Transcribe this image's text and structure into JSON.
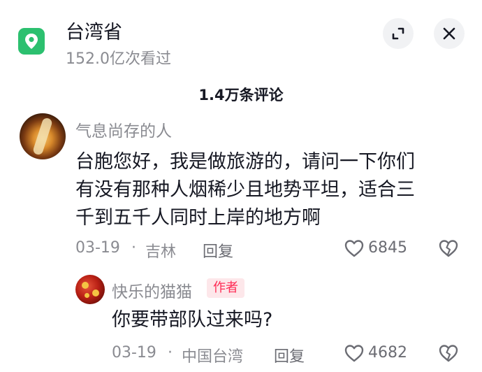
{
  "header": {
    "title": "台湾省",
    "views": "152.0亿次看过"
  },
  "comments_count": "1.4万条评论",
  "comment": {
    "username": "气息尚存的人",
    "lines": [
      "台胞您好，我是做旅游的，请问一下你们",
      "有没有那种人烟稀少且地势平坦，适合三",
      "千到五千人同时上岸的地方啊"
    ],
    "date": "03-19",
    "dot": "·",
    "location": "吉林",
    "reply_label": "回复",
    "likes": "6845"
  },
  "reply": {
    "username": "快乐的猫猫",
    "badge": "作者",
    "text": "你要带部队过来吗?",
    "date": "03-19",
    "dot": "·",
    "location": "中国台湾",
    "reply_label": "回复",
    "likes": "4682"
  },
  "colors": {
    "accent": "#fe2c55",
    "location_green": "#2cc06f",
    "secondary_text": "#8a8b91"
  }
}
